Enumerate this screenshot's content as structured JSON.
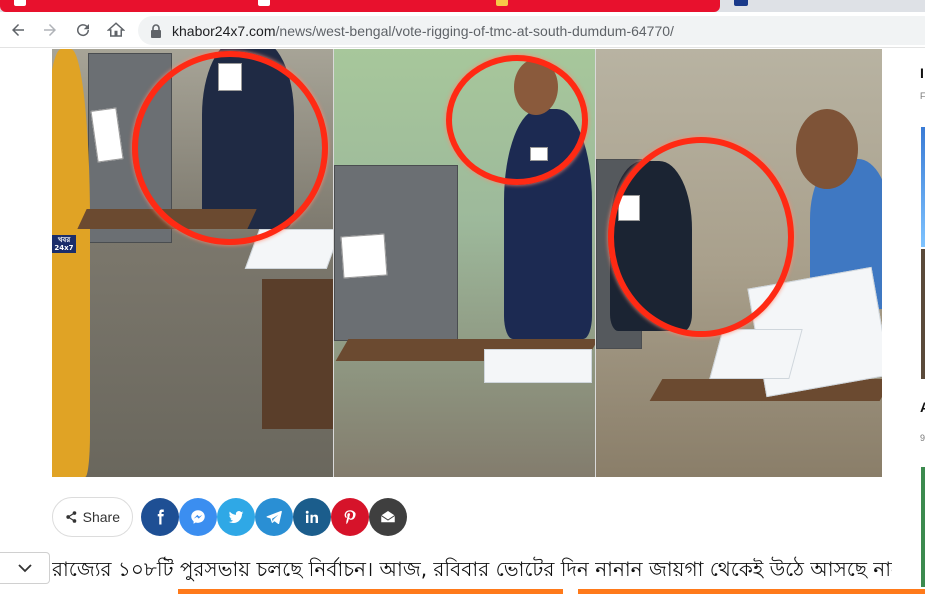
{
  "browser": {
    "url_host": "khabor24x7.com",
    "url_path": "/news/west-bengal/vote-rigging-of-tmc-at-south-dumdum-64770/"
  },
  "hero": {
    "watermark": "খবর 24x7"
  },
  "share": {
    "label": "Share",
    "buttons": [
      {
        "name": "facebook",
        "glyph": "f",
        "color": "#1e4f94"
      },
      {
        "name": "messenger",
        "glyph": "m",
        "color": "#3b8ef0"
      },
      {
        "name": "twitter",
        "glyph": "t",
        "color": "#2fa8e6"
      },
      {
        "name": "telegram",
        "glyph": "tg",
        "color": "#2a8fd4"
      },
      {
        "name": "linkedin",
        "glyph": "in",
        "color": "#1b5d8c"
      },
      {
        "name": "pinterest",
        "glyph": "p",
        "color": "#d6132a"
      },
      {
        "name": "email",
        "glyph": "e",
        "color": "#3f3f3f"
      }
    ]
  },
  "article": {
    "first_line": "রাজ্যের ১০৮টি পুরসভায় চলছে নির্বাচন। আজ, রবিবার ভোটের দিন নানান জায়গা থেকেই উঠে আসছে নানান"
  },
  "sidebar": {
    "letter_1": "I",
    "tiny_1": "F",
    "letter_2": "A",
    "tiny_2": "9"
  }
}
